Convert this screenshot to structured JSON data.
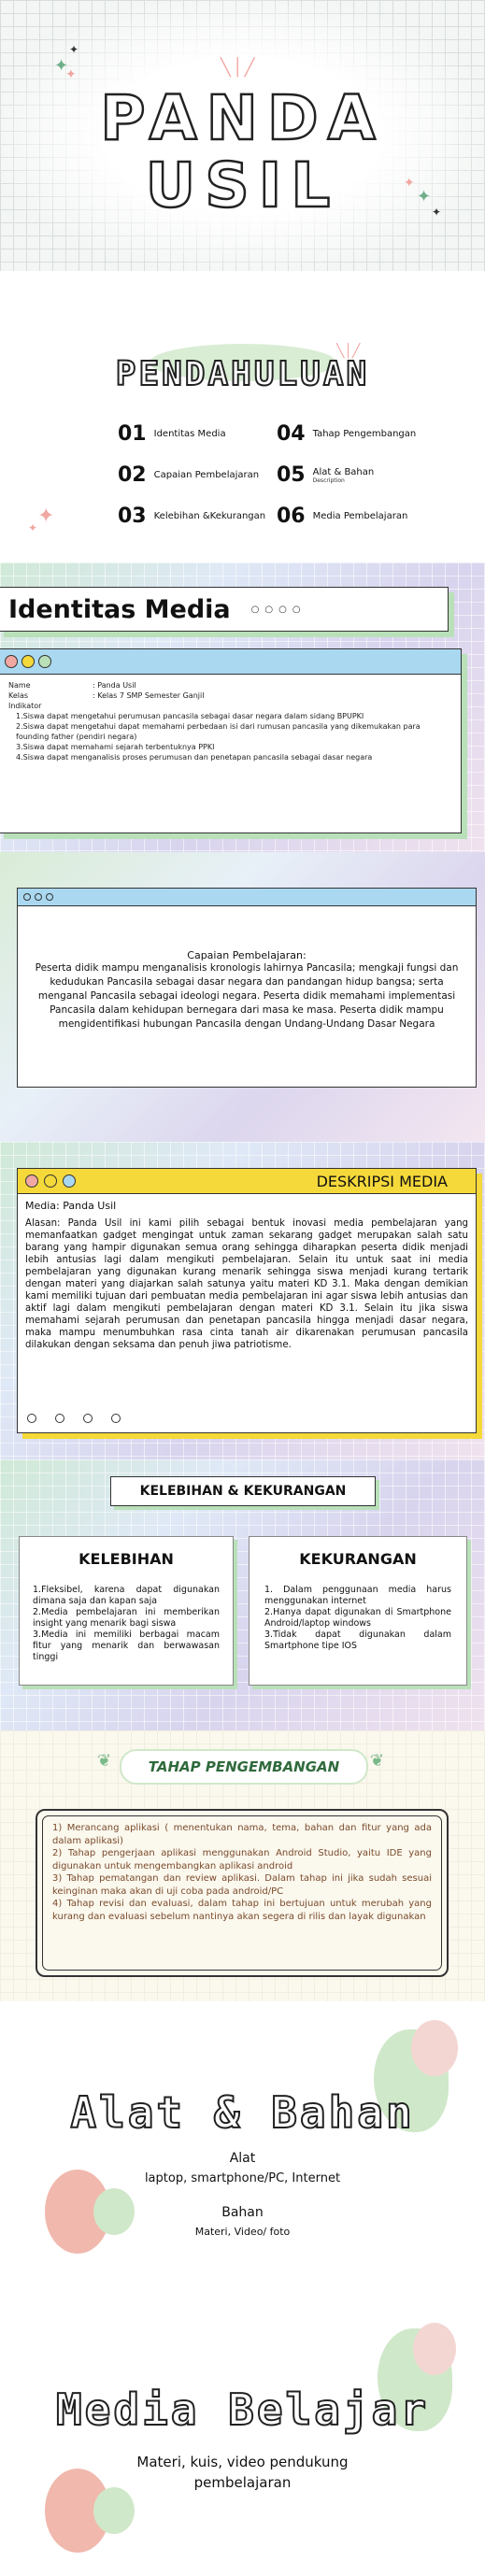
{
  "cover": {
    "title_line1": "PANDA",
    "title_line2": "USIL"
  },
  "intro": {
    "title": "PENDAHULUAN",
    "items": [
      {
        "num": "01",
        "label": "Identitas Media"
      },
      {
        "num": "02",
        "label": "Capaian Pembelajaran"
      },
      {
        "num": "03",
        "label": "Kelebihan &Kekurangan"
      },
      {
        "num": "04",
        "label": "Tahap Pengembangan"
      },
      {
        "num": "05",
        "label": "Alat & Bahan",
        "sub": "Description"
      },
      {
        "num": "06",
        "label": "Media Pembelajaran"
      }
    ]
  },
  "identitas": {
    "title": "Identitas Media",
    "rows": [
      {
        "k": "Name",
        "v": ": Panda Usil"
      },
      {
        "k": "Kelas",
        "v": ": Kelas 7 SMP Semester Ganjil"
      }
    ],
    "indikator_label": "Indikator",
    "indikator": [
      "1.Siswa dapat mengetahui perumusan pancasila sebagai dasar negara dalam sidang BPUPKI",
      "2.Siswa dapat mengetahui dapat memahami perbedaan isi dari rumusan pancasila yang dikemukakan para founding father (pendiri negara)",
      "3.Siswa dapat memahami sejarah terbentuknya PPKI",
      "4.Siswa dapat menganalisis proses perumusan dan penetapan pancasila sebagai dasar negara"
    ]
  },
  "capaian": {
    "heading": "Capaian Pembelajaran:",
    "text": "Peserta didik mampu menganalisis kronologis lahirnya Pancasila; mengkaji fungsi dan kedudukan Pancasila sebagai dasar negara dan pandangan hidup bangsa; serta menganal Pancasila sebagai ideologi negara. Peserta didik memahami implementasi Pancasila dalam kehidupan bernegara dari masa ke masa. Peserta didik mampu mengidentifikasi hubungan Pancasila dengan Undang-Undang Dasar Negara"
  },
  "deskripsi": {
    "title": "DESKRIPSI MEDIA",
    "media": "Media: Panda Usil",
    "text": "Alasan: Panda Usil ini kami pilih sebagai bentuk inovasi media pembelajaran yang memanfaatkan gadget mengingat untuk zaman sekarang gadget merupakan salah satu barang yang hampir digunakan semua orang sehingga diharapkan peserta didik menjadi lebih antusias lagi dalam mengikuti pembelajaran. Selain itu untuk saat ini media pembelajaran yang digunakan kurang menarik sehingga siswa menjadi kurang tertarik dengan materi yang diajarkan salah satunya yaitu materi KD 3.1. Maka dengan demikian kami memiliki tujuan dari pembuatan media pembelajaran ini agar siswa lebih antusias dan aktif lagi dalam mengikuti pembelajaran dengan materi KD 3.1. Selain itu jika siswa memahami sejarah perumusan dan penetapan pancasila hingga menjadi dasar negara, maka mampu menumbuhkan rasa cinta tanah air dikarenakan perumusan pancasila dilakukan dengan seksama dan penuh jiwa patriotisme."
  },
  "kelebihan_section": {
    "title": "KELEBIHAN & KEKURANGAN",
    "kelebihan_title": "KELEBIHAN",
    "kelebihan": [
      "1.Fleksibel, karena dapat digunakan dimana saja dan kapan saja",
      "2.Media pembelajaran ini memberikan insight yang menarik bagi siswa",
      "3.Media ini memiliki berbagai macam fitur yang menarik dan berwawasan tinggi"
    ],
    "kekurangan_title": "KEKURANGAN",
    "kekurangan": [
      "1. Dalam penggunaan media harus menggunakan internet",
      "2.Hanya dapat digunakan di Smartphone Android/laptop windows",
      "3.Tidak dapat digunakan dalam Smartphone tipe IOS"
    ]
  },
  "tahap": {
    "title": "TAHAP PENGEMBANGAN",
    "items": [
      "1) Merancang aplikasi ( menentukan nama, tema, bahan dan fitur yang ada dalam aplikasi)",
      "2) Tahap pengerjaan aplikasi menggunakan Android Studio, yaitu IDE yang digunakan untuk mengembangkan aplikasi android",
      "3) Tahap pematangan dan review aplikasi. Dalam tahap ini jika sudah sesuai keinginan maka akan di uji coba pada android/PC",
      "4) Tahap revisi dan evaluasi, dalam tahap ini bertujuan untuk merubah yang kurang dan evaluasi sebelum nantinya akan segera di rilis dan layak digunakan"
    ]
  },
  "alat": {
    "title": "Alat & Bahan",
    "alat_label": "Alat",
    "alat_value": "laptop, smartphone/PC, Internet",
    "bahan_label": "Bahan",
    "bahan_value": "Materi, Video/ foto"
  },
  "media": {
    "title": "Media Belajar",
    "line1": "Materi, kuis, video pendukung",
    "line2": "pembelajaran"
  },
  "colors": {
    "green_shadow": "#b9e0b9",
    "yellow": "#f5d93a",
    "blue_bar": "#a9d8f0",
    "pink": "#f1a7a2",
    "cream": "#fbf8ee"
  }
}
